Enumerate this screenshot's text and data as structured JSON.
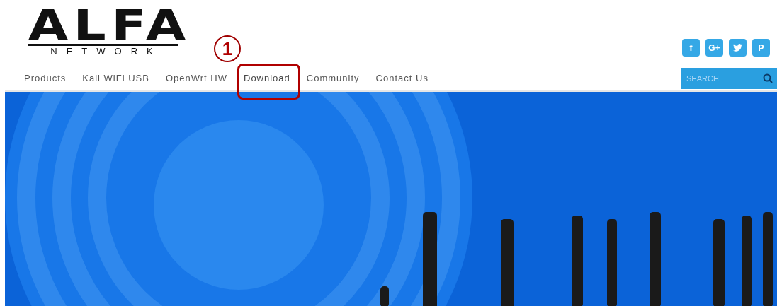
{
  "logo": {
    "name": "ALFA",
    "tagline": "NETWORK"
  },
  "nav": [
    {
      "label": "Products",
      "selected": false,
      "annotated": false
    },
    {
      "label": "Kali WiFi USB",
      "selected": false,
      "annotated": false
    },
    {
      "label": "OpenWrt HW",
      "selected": false,
      "annotated": false
    },
    {
      "label": "Download",
      "selected": true,
      "annotated": true
    },
    {
      "label": "Community",
      "selected": false,
      "annotated": false
    },
    {
      "label": "Contact Us",
      "selected": false,
      "annotated": false
    }
  ],
  "annotation": {
    "number": "1"
  },
  "social": [
    {
      "kind": "glyph",
      "glyph": "f"
    },
    {
      "kind": "glyph",
      "glyph": "G+"
    },
    {
      "kind": "bird"
    },
    {
      "kind": "glyph",
      "glyph": "P"
    }
  ],
  "search": {
    "placeholder": "SEARCH"
  }
}
